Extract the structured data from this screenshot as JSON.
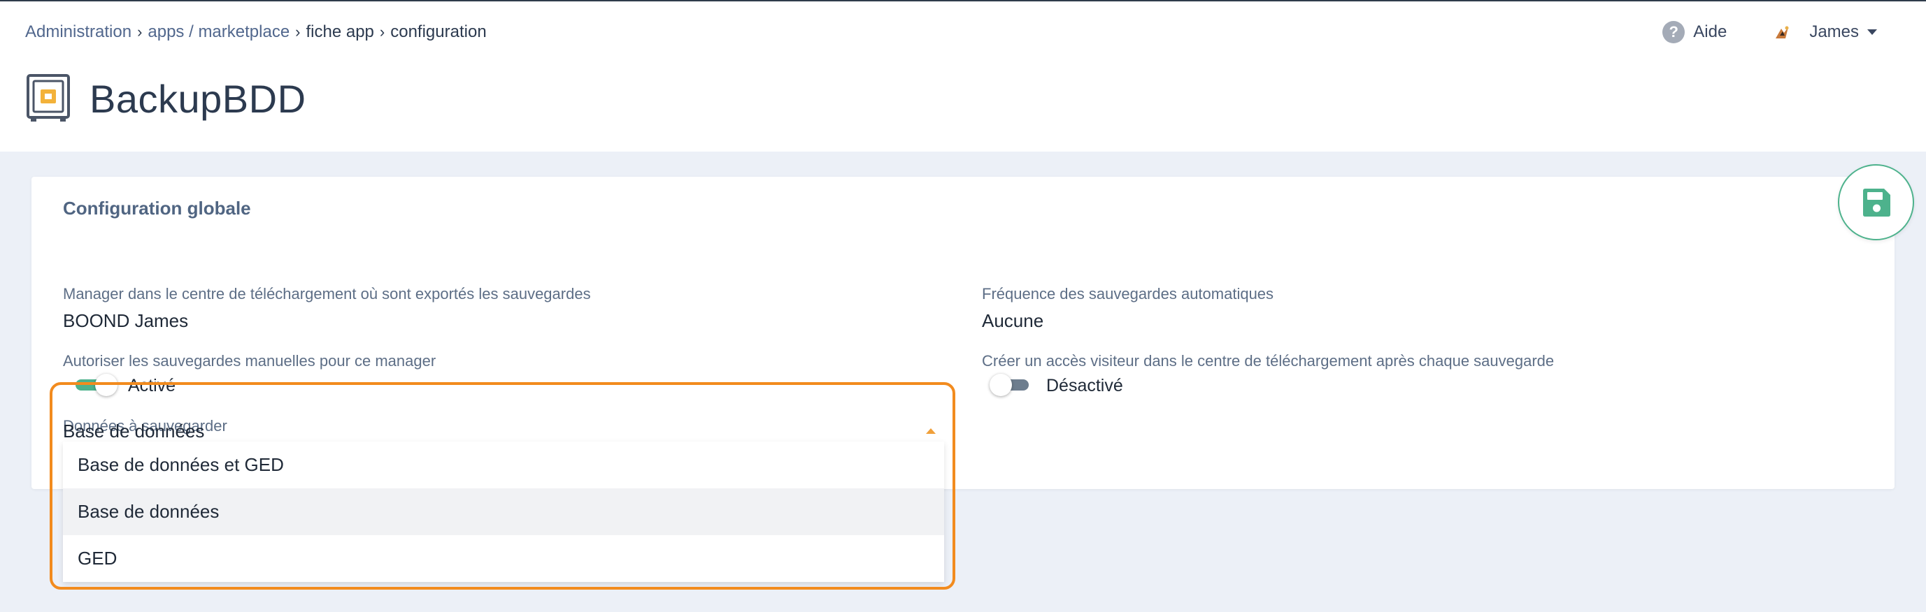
{
  "breadcrumb": {
    "items": [
      "Administration",
      "apps / marketplace",
      "fiche app",
      "configuration"
    ]
  },
  "header": {
    "help_label": "Aide",
    "user_name": "James",
    "app_title": "BackupBDD"
  },
  "card": {
    "title": "Configuration globale",
    "manager_label": "Manager dans le centre de téléchargement où sont exportés les sauvegardes",
    "manager_value": "BOOND James",
    "frequency_label": "Fréquence des sauvegardes automatiques",
    "frequency_value": "Aucune",
    "manual_label": "Autoriser les sauvegardes manuelles pour ce manager",
    "manual_toggle": {
      "state": true,
      "label": "Activé"
    },
    "visitor_label": "Créer un accès visiteur dans le centre de téléchargement après chaque sauvegarde",
    "visitor_toggle": {
      "state": false,
      "label": "Désactivé"
    },
    "data_label": "Données à sauvegarder",
    "data_value": "Base de données",
    "data_options": [
      "Base de données et GED",
      "Base de données",
      "GED"
    ]
  },
  "colors": {
    "accent_green": "#4db28c",
    "highlight_orange": "#f28b1e",
    "select_underline": "#f0a03a",
    "background": "#ecf0f7"
  },
  "icons": {
    "help": "question-circle-icon",
    "user": "avatar-icon",
    "app": "safe-icon",
    "save": "floppy-disk-icon"
  }
}
